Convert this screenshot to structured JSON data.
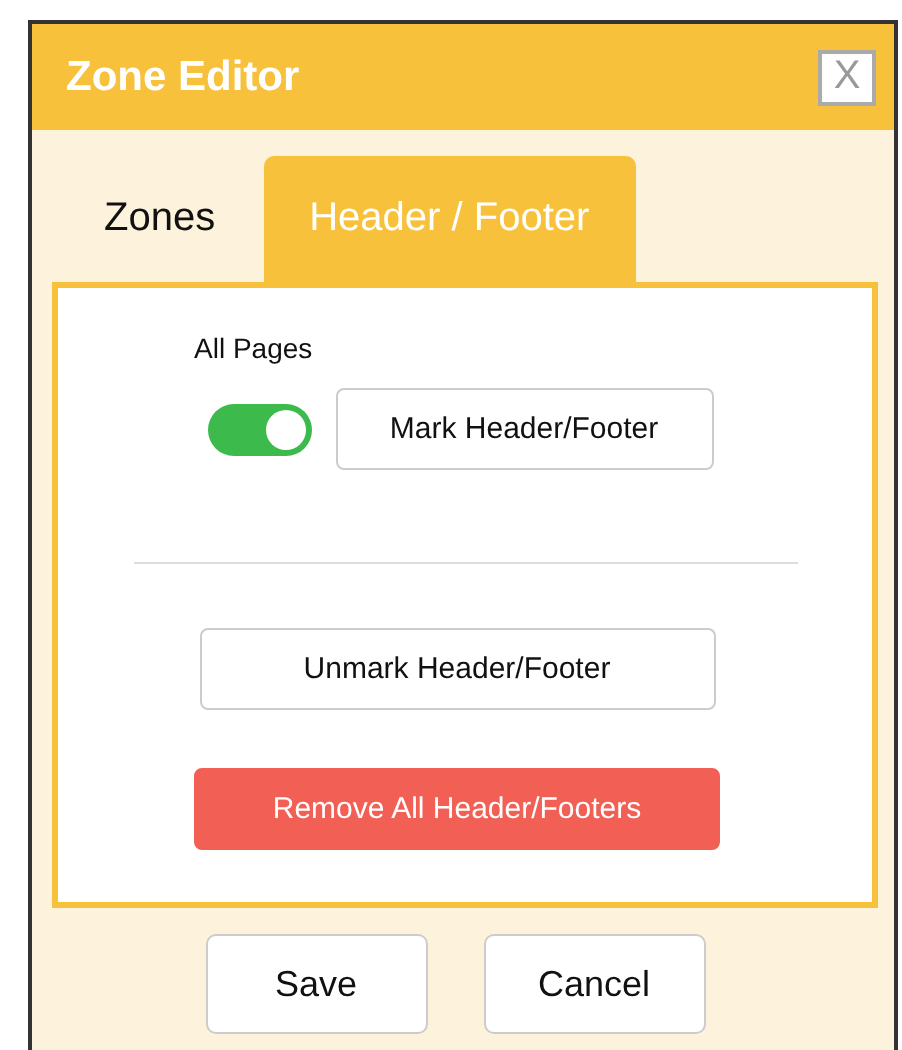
{
  "window": {
    "title": "Zone Editor",
    "close": "X"
  },
  "tabs": [
    {
      "label": "Zones",
      "selected": false
    },
    {
      "label": "Header / Footer",
      "selected": true
    }
  ],
  "panel": {
    "all_pages_label": "All Pages",
    "all_pages_on": true,
    "mark_button": "Mark Header/Footer",
    "unmark_button": "Unmark Header/Footer",
    "remove_button": "Remove All Header/Footers"
  },
  "buttons": [
    "Save",
    "Cancel"
  ]
}
